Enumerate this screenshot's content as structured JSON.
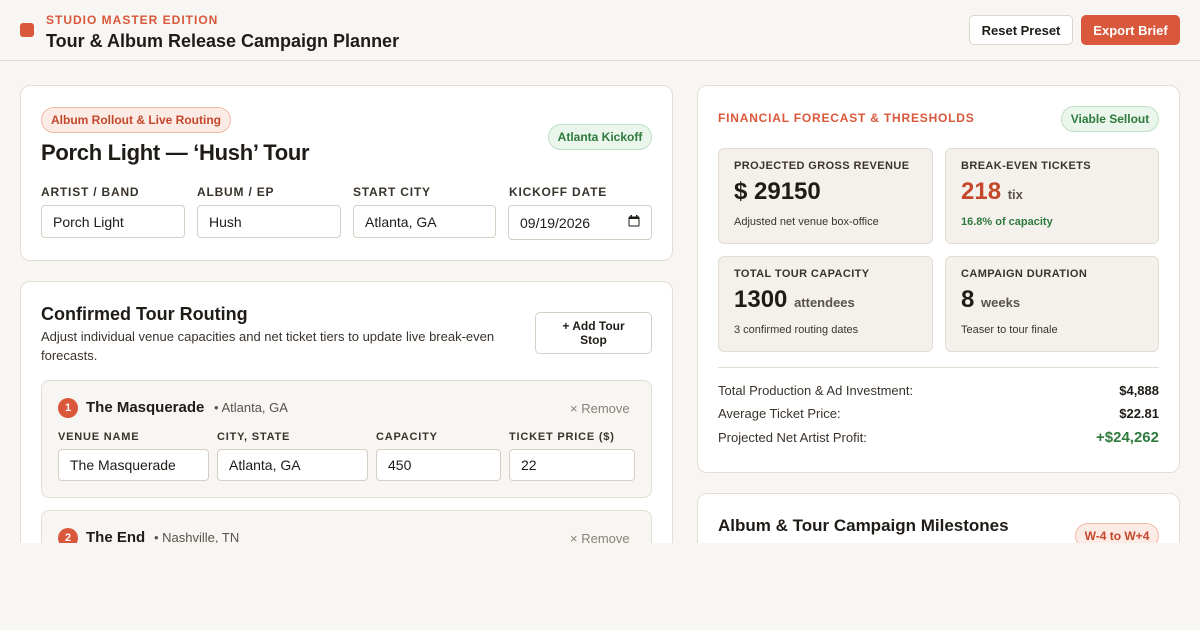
{
  "header": {
    "edition": "STUDIO MASTER EDITION",
    "title": "Tour & Album Release Campaign Planner",
    "reset_label": "Reset Preset",
    "export_label": "Export Brief",
    "accent": "#d9573a"
  },
  "campaign": {
    "tag": "Album Rollout & Live Routing",
    "badge": "Atlanta Kickoff",
    "name": "Porch Light — ‘Hush’ Tour",
    "fields": {
      "artist_label": "ARTIST / BAND",
      "artist_value": "Porch Light",
      "album_label": "ALBUM / EP",
      "album_value": "Hush",
      "city_label": "START CITY",
      "city_value": "Atlanta, GA",
      "date_label": "KICKOFF DATE",
      "date_value": "09/19/2026"
    }
  },
  "routing": {
    "title": "Confirmed Tour Routing",
    "subtitle": "Adjust individual venue capacities and net ticket tiers to update live break-even forecasts.",
    "add_label": "+ Add Tour Stop",
    "remove_label": "× Remove",
    "col_labels": {
      "venue": "VENUE NAME",
      "city": "CITY, STATE",
      "capacity": "CAPACITY",
      "price": "TICKET PRICE ($)"
    },
    "stops": [
      {
        "num": "1",
        "name": "The Masquerade",
        "loc": "• Atlanta, GA",
        "venue": "The Masquerade",
        "city": "Atlanta, GA",
        "capacity": "450",
        "price": "22"
      },
      {
        "num": "2",
        "name": "The End",
        "loc": "• Nashville, TN"
      }
    ]
  },
  "forecast": {
    "title": "FINANCIAL FORECAST & THRESHOLDS",
    "badge": "Viable Sellout",
    "metrics": {
      "gross_title": "PROJECTED GROSS REVENUE",
      "gross_value": "$ 29150",
      "gross_note": "Adjusted net venue box-office",
      "breakeven_title": "BREAK-EVEN TICKETS",
      "breakeven_value": "218",
      "breakeven_unit": "tix",
      "breakeven_note": "16.8% of capacity",
      "capacity_title": "TOTAL TOUR CAPACITY",
      "capacity_value": "1300",
      "capacity_unit": "attendees",
      "capacity_note": "3 confirmed routing dates",
      "duration_title": "CAMPAIGN DURATION",
      "duration_value": "8",
      "duration_unit": "weeks",
      "duration_note": "Teaser to tour finale"
    },
    "summary": {
      "investment_label": "Total Production & Ad Investment:",
      "investment_value": "$4,888",
      "avg_label": "Average Ticket Price:",
      "avg_value": "$22.81",
      "profit_label": "Projected Net Artist Profit:",
      "profit_value": "+$24,262"
    }
  },
  "milestones": {
    "title": "Album & Tour Campaign Milestones",
    "badge": "W-4 to W+4"
  }
}
